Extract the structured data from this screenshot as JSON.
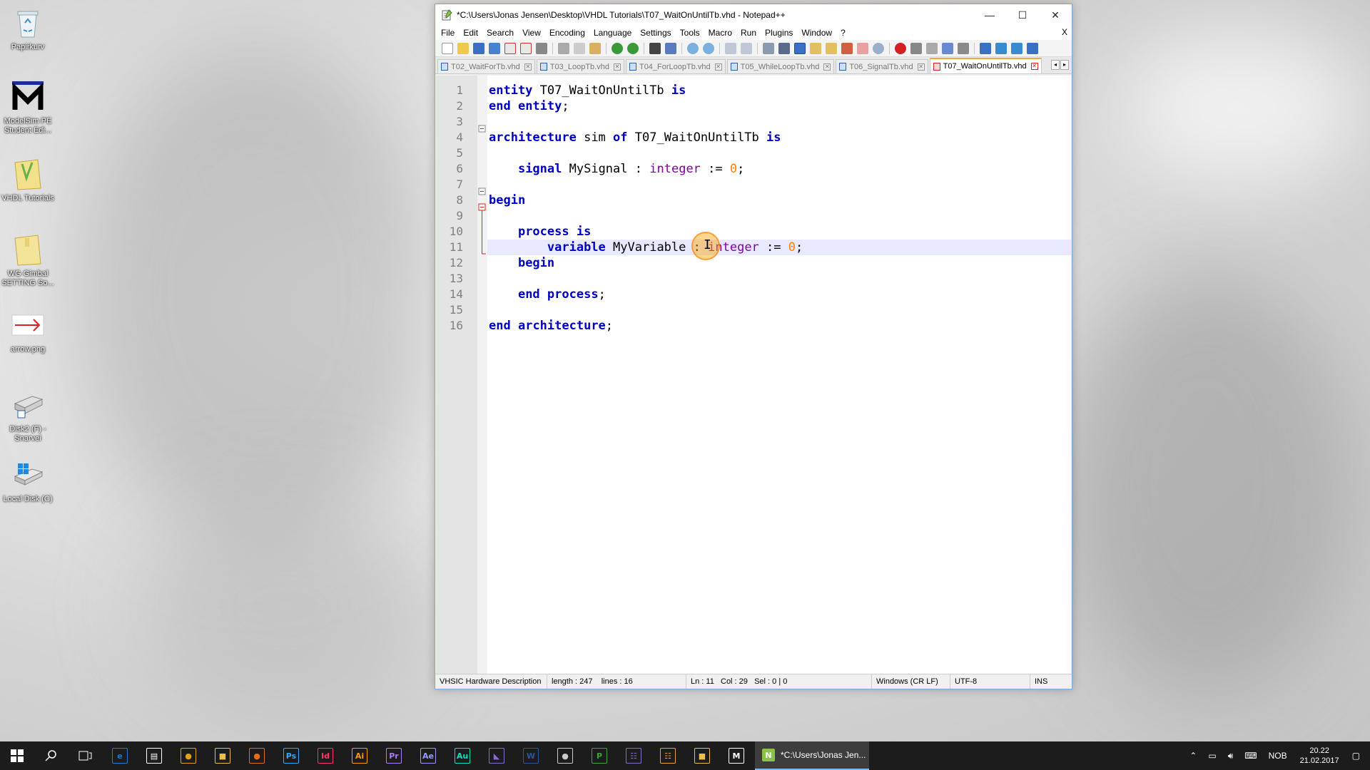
{
  "desktop": {
    "icons": [
      {
        "label": "Papirkurv",
        "icon": "recycle-bin-icon"
      },
      {
        "label": "ModelSim PE Student Edi...",
        "icon": "modelsim-icon"
      },
      {
        "label": "VHDL Tutorials",
        "icon": "folder-icon"
      },
      {
        "label": "WG Gimbal SETTING So...",
        "icon": "folder-icon"
      },
      {
        "label": "arrow.png",
        "icon": "image-file-icon"
      },
      {
        "label": "Disk2 (F) - Snarvei",
        "icon": "network-drive-icon"
      },
      {
        "label": "Local Disk (C)",
        "icon": "local-disk-icon"
      }
    ]
  },
  "window": {
    "title": "*C:\\Users\\Jonas Jensen\\Desktop\\VHDL Tutorials\\T07_WaitOnUntilTb.vhd - Notepad++",
    "minimize": "—",
    "maximize": "☐",
    "close": "✕",
    "menu": [
      "File",
      "Edit",
      "Search",
      "View",
      "Encoding",
      "Language",
      "Settings",
      "Tools",
      "Macro",
      "Run",
      "Plugins",
      "Window",
      "?"
    ],
    "menu_close": "X"
  },
  "tabs": [
    {
      "label": "T02_WaitForTb.vhd",
      "active": false
    },
    {
      "label": "T03_LoopTb.vhd",
      "active": false
    },
    {
      "label": "T04_ForLoopTb.vhd",
      "active": false
    },
    {
      "label": "T05_WhileLoopTb.vhd",
      "active": false
    },
    {
      "label": "T06_SignalTb.vhd",
      "active": false
    },
    {
      "label": "T07_WaitOnUntilTb.vhd",
      "active": true
    }
  ],
  "tab_nav": {
    "prev": "◂",
    "next": "▸"
  },
  "editor": {
    "line_numbers": [
      "1",
      "2",
      "3",
      "4",
      "5",
      "6",
      "7",
      "8",
      "9",
      "10",
      "11",
      "12",
      "13",
      "14",
      "15",
      "16"
    ],
    "lines": [
      "entity T07_WaitOnUntilTb is",
      "end entity;",
      "",
      "architecture sim of T07_WaitOnUntilTb is",
      "",
      "    signal MySignal : integer := 0;",
      "",
      "begin",
      "",
      "    process is",
      "        variable MyVariable : integer := 0;",
      "    begin",
      "",
      "    end process;",
      "",
      "end architecture;"
    ],
    "current_line": 11
  },
  "status": {
    "language": "VHSIC Hardware Description",
    "length": "length : 247",
    "lines": "lines : 16",
    "ln": "Ln : 11",
    "col": "Col : 29",
    "sel": "Sel : 0 | 0",
    "eol": "Windows (CR LF)",
    "encoding": "UTF-8",
    "mode": "INS"
  },
  "taskbar": {
    "apps": [
      {
        "name": "edge",
        "glyph": "e",
        "color": "#1e7ad6"
      },
      {
        "name": "store",
        "glyph": "▤",
        "color": "#ffffff"
      },
      {
        "name": "chrome",
        "glyph": "●",
        "color": "#e0a020"
      },
      {
        "name": "explorer",
        "glyph": "■",
        "color": "#e8c04a"
      },
      {
        "name": "firefox",
        "glyph": "●",
        "color": "#e66b1e"
      },
      {
        "name": "photoshop",
        "glyph": "Ps",
        "color": "#31a8ff"
      },
      {
        "name": "indesign",
        "glyph": "Id",
        "color": "#ff3366"
      },
      {
        "name": "illustrator",
        "glyph": "Ai",
        "color": "#ff9a00"
      },
      {
        "name": "premiere",
        "glyph": "Pr",
        "color": "#b07cff"
      },
      {
        "name": "after-effects",
        "glyph": "Ae",
        "color": "#9999ff"
      },
      {
        "name": "audition",
        "glyph": "Au",
        "color": "#00e4bb"
      },
      {
        "name": "visual-studio",
        "glyph": "◣",
        "color": "#8a6ad2"
      },
      {
        "name": "word",
        "glyph": "W",
        "color": "#2b579a"
      },
      {
        "name": "skype",
        "glyph": "●",
        "color": "#cccccc"
      },
      {
        "name": "app-green",
        "glyph": "P",
        "color": "#3aa53a"
      },
      {
        "name": "calculator",
        "glyph": "☷",
        "color": "#8a6ad2"
      },
      {
        "name": "grid-app",
        "glyph": "☷",
        "color": "#f0a030"
      },
      {
        "name": "folder-app",
        "glyph": "■",
        "color": "#e8c04a"
      },
      {
        "name": "modelsim",
        "glyph": "M",
        "color": "#ffffff"
      }
    ],
    "active_label": "*C:\\Users\\Jonas Jen...",
    "lang": "NOB",
    "time": "20.22",
    "date": "21.02.2017"
  }
}
